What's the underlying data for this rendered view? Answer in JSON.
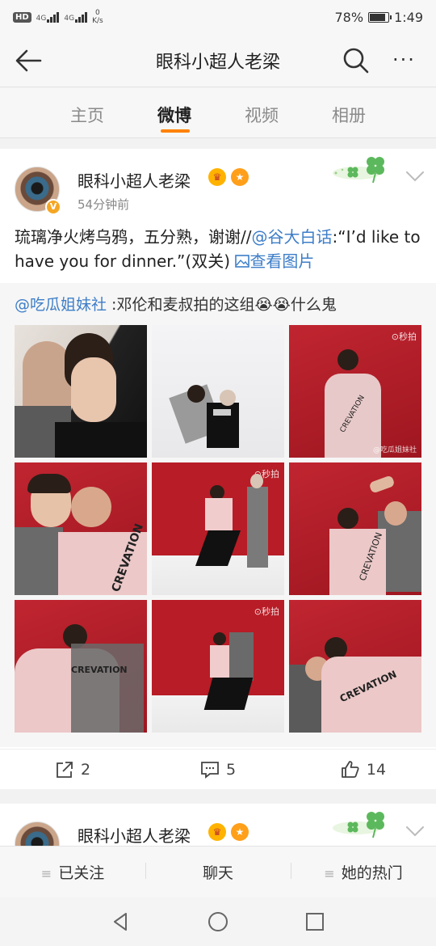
{
  "status_bar": {
    "hd": "HD",
    "sig1_label": "4G",
    "sig2_label": "4G",
    "speed_value": "0",
    "speed_unit": "K/s",
    "battery": "78%",
    "time": "1:49"
  },
  "nav": {
    "title": "眼科小超人老梁",
    "back_icon": "arrow-left-icon",
    "search_icon": "search-icon",
    "more_label": "···"
  },
  "tabs": [
    {
      "label": "主页",
      "active": false
    },
    {
      "label": "微博",
      "active": true
    },
    {
      "label": "视频",
      "active": false
    },
    {
      "label": "相册",
      "active": false
    }
  ],
  "post": {
    "author": "眼科小超人老梁",
    "time": "54分钟前",
    "verified_badge": "V",
    "text_prefix": "琉璃净火烤乌鸦，五分熟，谢谢//",
    "mention": "@谷大白话",
    "text_mid": ":“I’d like to have you for dinner.”(双关) ",
    "view_image": "查看图片",
    "repost": {
      "mention": "@吃瓜姐妹社",
      "text": " :邓伦和麦叔拍的这组",
      "emoji": "😭😭",
      "text_end": "什么鬼"
    },
    "photo_watermark": "秒拍",
    "photo_watermark2": "@吃瓜姐妹社",
    "photo_shirt_text": "CREVATION",
    "actions": {
      "repost_count": "2",
      "comment_count": "5",
      "like_count": "14"
    }
  },
  "post2": {
    "author": "眼科小超人老梁"
  },
  "bottom_bar": {
    "follow": "已关注",
    "chat": "聊天",
    "hot": "她的热门"
  },
  "colors": {
    "accent": "#ff8200",
    "link": "#3d7ec8"
  }
}
